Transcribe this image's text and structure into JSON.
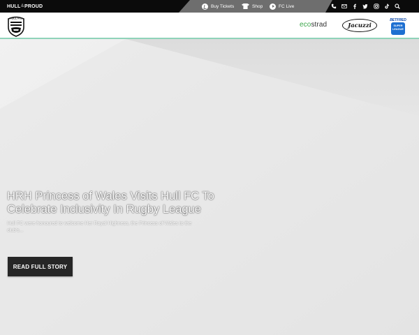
{
  "topbar": {
    "brand": {
      "left": "HULL",
      "amp": "&",
      "right": "PROUD"
    },
    "links": [
      {
        "label": "Buy Tickets",
        "icon": "ticket-icon"
      },
      {
        "label": "Shop",
        "icon": "shirt-icon"
      },
      {
        "label": "FC Live",
        "icon": "play-icon"
      }
    ],
    "social": [
      "phone-icon",
      "email-icon",
      "facebook-icon",
      "twitter-icon",
      "instagram-icon",
      "tiktok-icon",
      "search-icon"
    ]
  },
  "header": {
    "crest_text": "HULL F.C.",
    "sponsors": {
      "ecostrad": {
        "eco": "eco",
        "rest": "strad"
      },
      "jacuzzi": "Jacuzzi",
      "betfred": "BETFRED",
      "super_league_line1": "SUPER",
      "super_league_line2": "LEAGUE"
    },
    "accent_color": "#8fd3b9"
  },
  "hero": {
    "headline": "HRH Princess of Wales Visits Hull FC To Celebrate Inclusivity In Rugby League",
    "excerpt": "Hull FC were honoured to welcome Her Royal Highness, the Princess of Wales to the club's...",
    "cta_label": "Read Full Story"
  }
}
